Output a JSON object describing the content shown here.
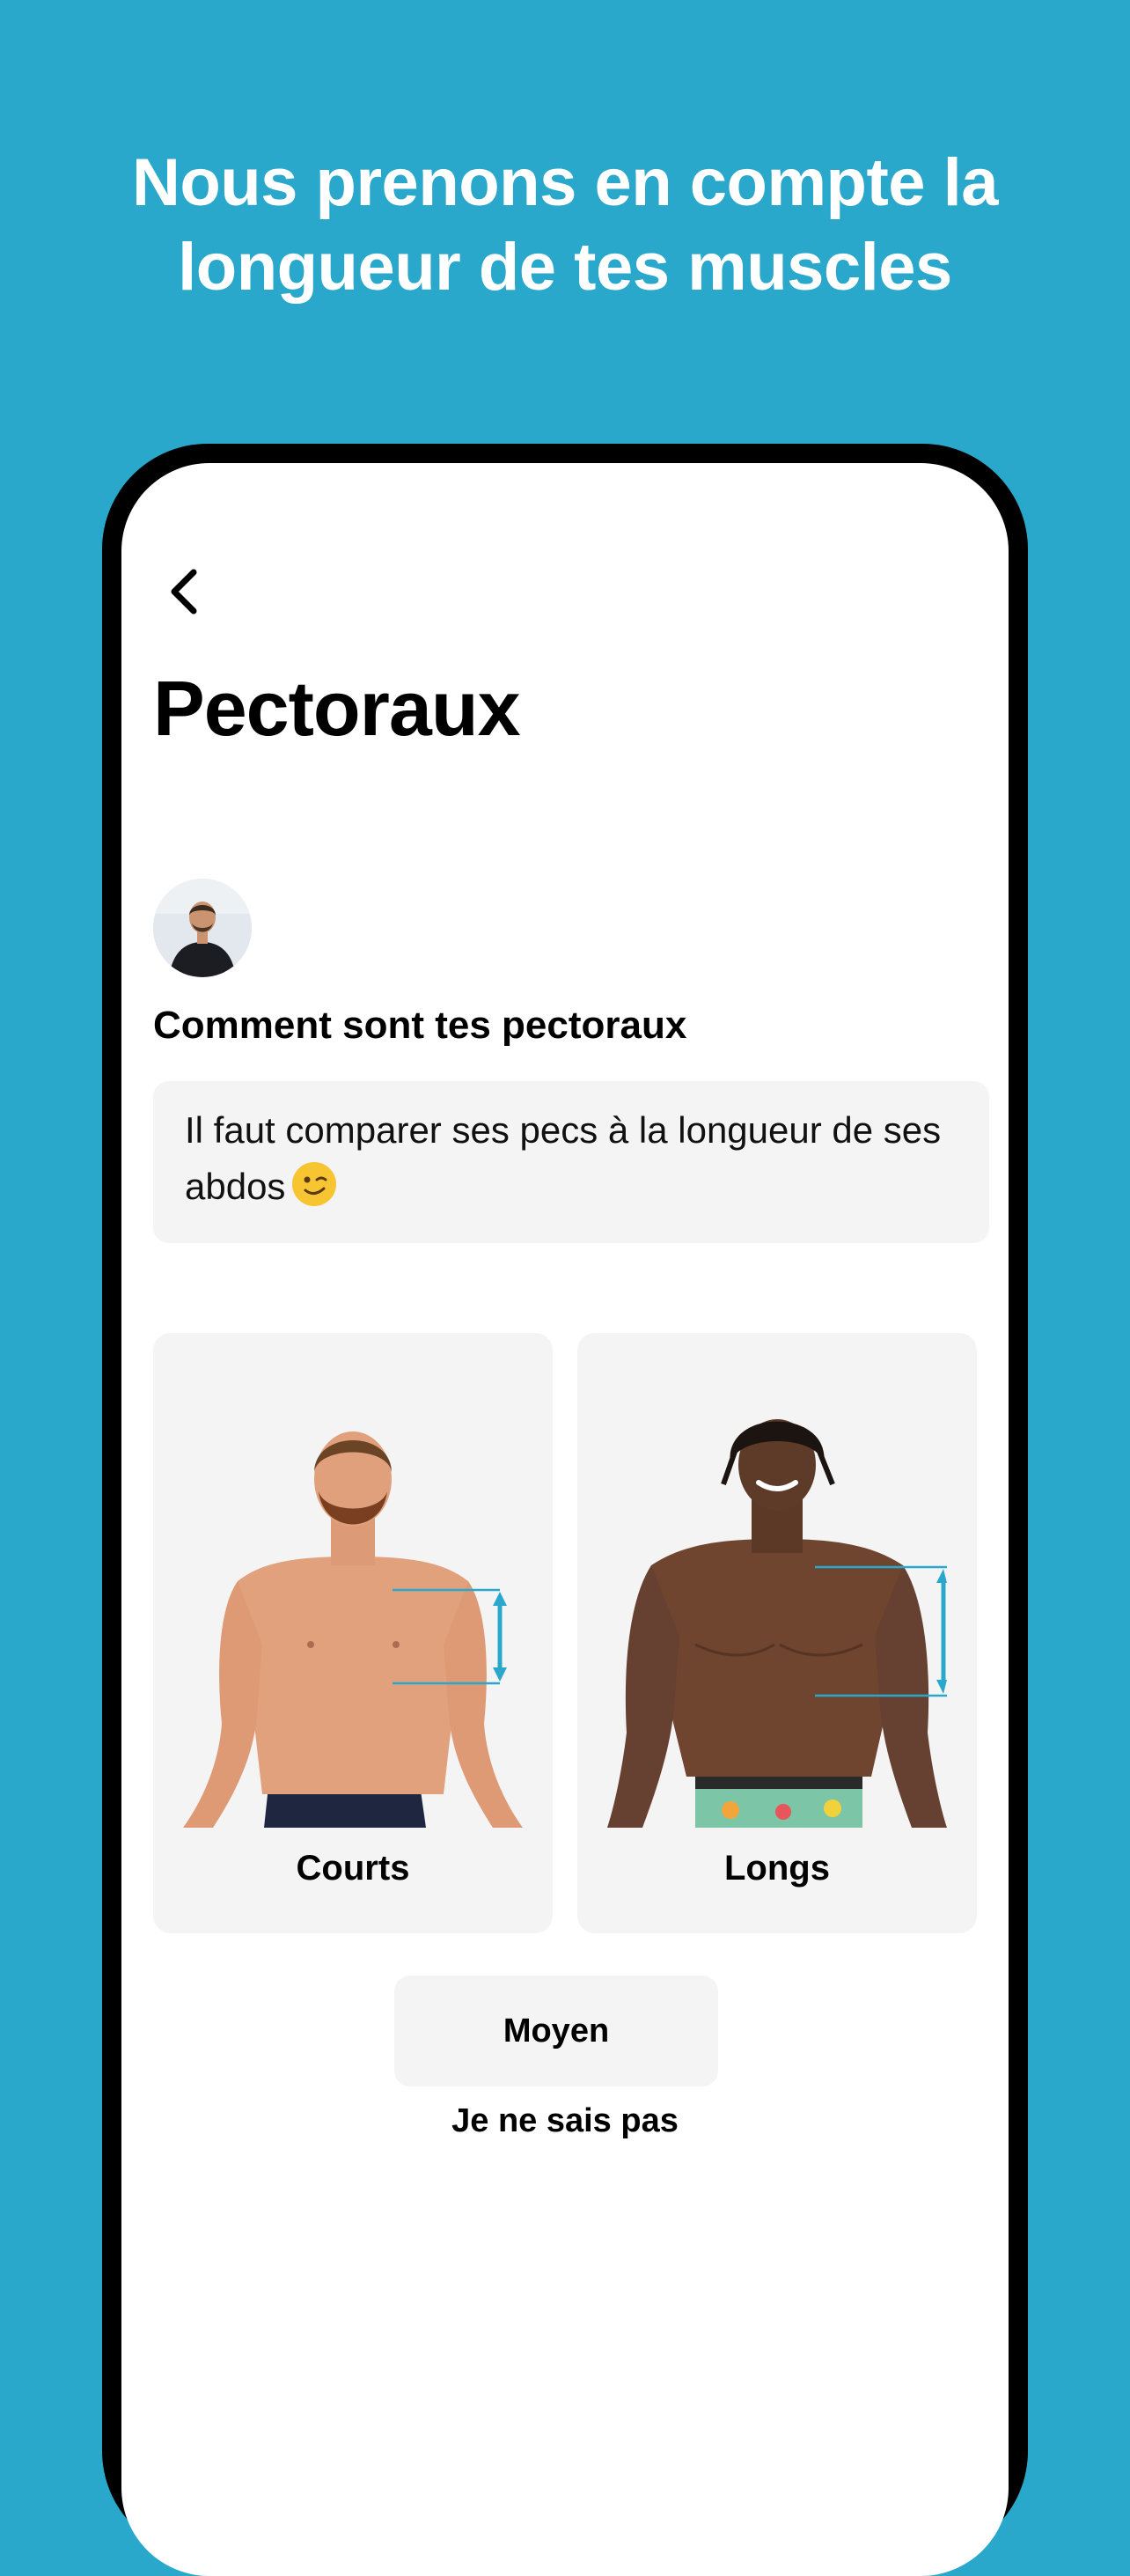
{
  "headline": {
    "line1": "Nous prenons en compte la",
    "line2": "longueur de tes muscles"
  },
  "screen": {
    "back_icon": "chevron-left-icon",
    "title": "Pectoraux",
    "question": "Comment sont tes pectoraux",
    "hint": "Il faut comparer ses pecs à la longueur de ses abdos",
    "hint_emoji": "winking-face-icon",
    "options": {
      "short": "Courts",
      "long": "Longs",
      "medium": "Moyen",
      "unknown": "Je ne sais pas"
    }
  },
  "colors": {
    "background": "#2aa8cc",
    "accent": "#2aa8cc",
    "card": "#f4f4f4"
  }
}
